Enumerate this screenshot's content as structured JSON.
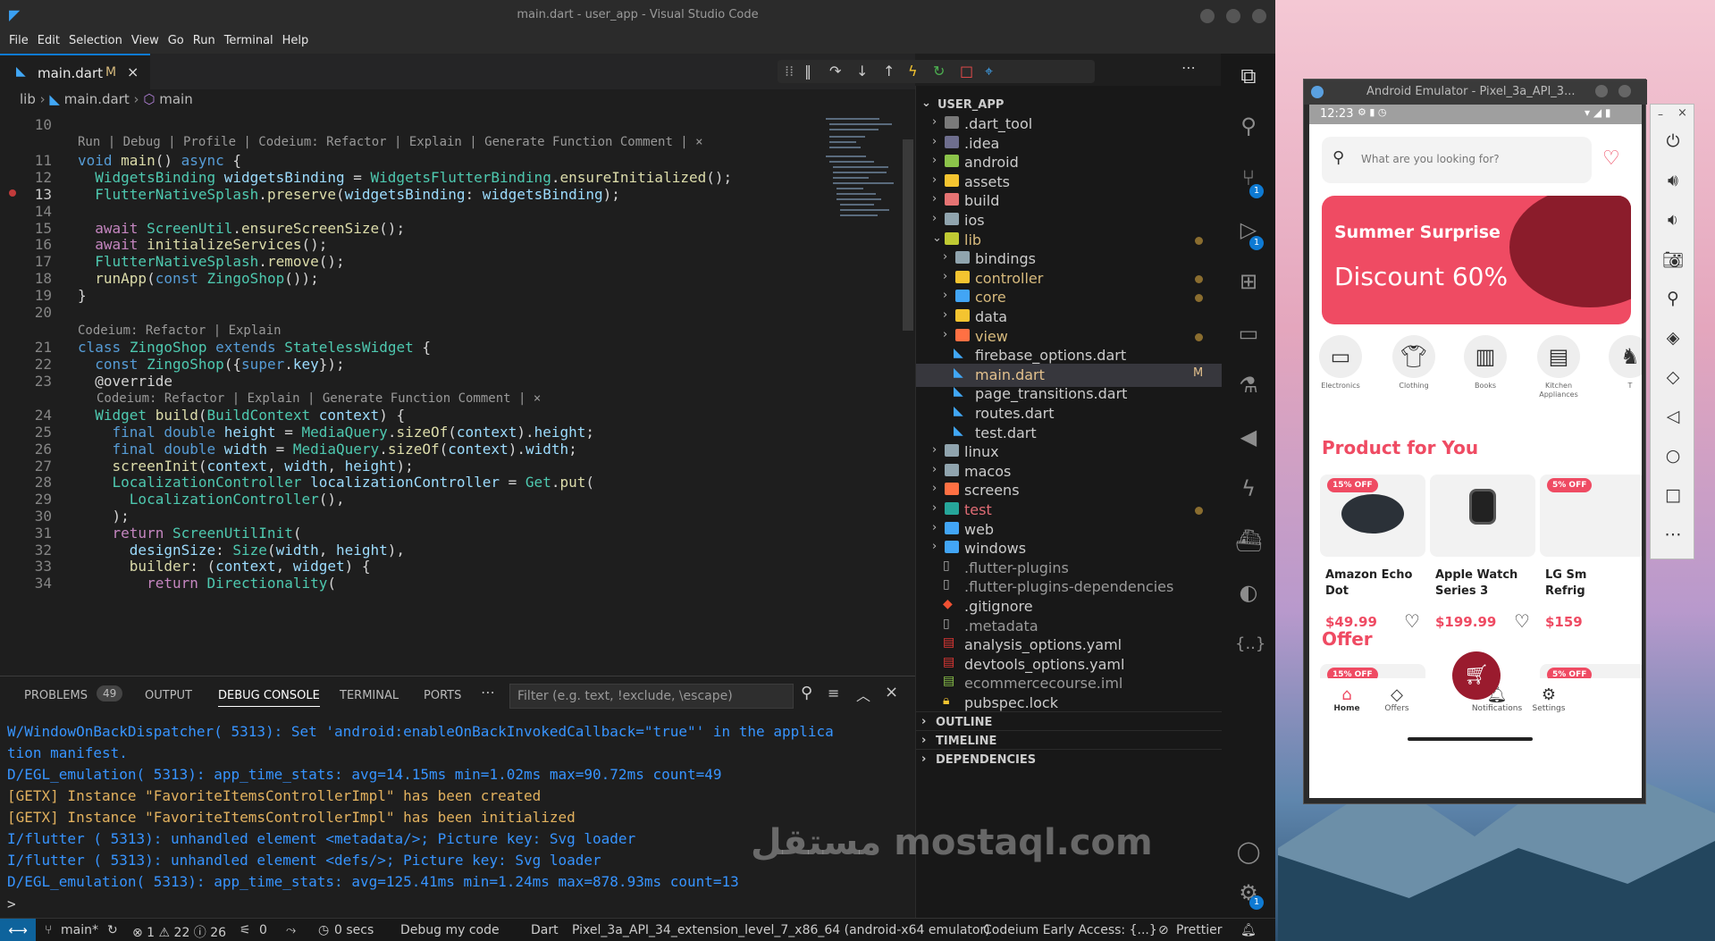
{
  "window": {
    "title": "main.dart - user_app - Visual Studio Code"
  },
  "menu": [
    "File",
    "Edit",
    "Selection",
    "View",
    "Go",
    "Run",
    "Terminal",
    "Help"
  ],
  "editor": {
    "tab": {
      "name": "main.dart",
      "status": "M",
      "close": "×"
    },
    "breadcrumb": {
      "folder": "lib",
      "file": "main.dart",
      "symbol": "main"
    },
    "lens_top": "Run | Debug | Profile | Codeium: Refactor | Explain | Generate Function Comment | ×",
    "lens_class": "Codeium: Refactor | Explain",
    "lens_build": "Codeium: Refactor | Explain | Generate Function Comment | ×",
    "line_numbers": [
      "10",
      "11",
      "12",
      "13",
      "14",
      "15",
      "16",
      "17",
      "18",
      "19",
      "20",
      "21",
      "22",
      "23",
      "24",
      "25",
      "26",
      "27",
      "28",
      "29",
      "30",
      "31",
      "32",
      "33",
      "34"
    ],
    "lines": {
      "l11": "void main() async {",
      "l12": "  WidgetsBinding widgetsBinding = WidgetsFlutterBinding.ensureInitialized();",
      "l13": "  FlutterNativeSplash.preserve(widgetsBinding: widgetsBinding);",
      "l15": "  await ScreenUtil.ensureScreenSize();",
      "l16": "  await initializeServices();",
      "l17": "  FlutterNativeSplash.remove();",
      "l18": "  runApp(const ZingoShop());",
      "l19": "}",
      "l21": "class ZingoShop extends StatelessWidget {",
      "l22": "  const ZingoShop({super.key});",
      "l23": "  @override",
      "l24": "  Widget build(BuildContext context) {",
      "l25": "    final double height = MediaQuery.sizeOf(context).height;",
      "l26": "    final double width = MediaQuery.sizeOf(context).width;",
      "l27": "    screenInit(context, width, height);",
      "l28": "    LocalizationController localizationController = Get.put(",
      "l29": "      LocalizationController(),",
      "l30": "    );",
      "l31": "    return ScreenUtilInit(",
      "l32": "      designSize: Size(width, height),",
      "l33": "      builder: (context, widget) {",
      "l34": "        return Directionality("
    }
  },
  "panel": {
    "tabs": [
      "PROBLEMS",
      "OUTPUT",
      "DEBUG CONSOLE",
      "TERMINAL",
      "PORTS"
    ],
    "problems_count": "49",
    "filter_placeholder": "Filter (e.g. text, !exclude, \\escape)",
    "console": [
      "W/WindowOnBackDispatcher( 5313): Set 'android:enableOnBackInvokedCallback=\"true\"' in the applica",
      "tion manifest.",
      "D/EGL_emulation( 5313): app_time_stats: avg=14.15ms min=1.02ms max=90.72ms count=49",
      "[GETX] Instance \"FavoriteItemsControllerImpl\" has been created",
      "[GETX] Instance \"FavoriteItemsControllerImpl\" has been initialized",
      "I/flutter ( 5313): unhandled element <metadata/>; Picture key: Svg loader",
      "I/flutter ( 5313): unhandled element <defs/>; Picture key: Svg loader",
      "D/EGL_emulation( 5313): app_time_stats: avg=125.41ms min=1.24ms max=878.93ms count=13"
    ],
    "prompt": ">"
  },
  "explorer": {
    "root": "USER_APP",
    "items": [
      {
        "label": ".dart_tool",
        "type": "folder",
        "color": "#7a7a7a"
      },
      {
        "label": ".idea",
        "type": "folder",
        "color": "#6e6e8e"
      },
      {
        "label": "android",
        "type": "folder",
        "color": "#8bc34a"
      },
      {
        "label": "assets",
        "type": "folder",
        "color": "#f4c430"
      },
      {
        "label": "build",
        "type": "folder",
        "color": "#e57373"
      },
      {
        "label": "ios",
        "type": "folder",
        "color": "#90a4ae"
      },
      {
        "label": "lib",
        "type": "folder-open",
        "color": "#c0ca33",
        "modified": true
      },
      {
        "label": "bindings",
        "type": "folder",
        "color": "#90a4ae"
      },
      {
        "label": "controller",
        "type": "folder",
        "color": "#f4c430",
        "modified": true
      },
      {
        "label": "core",
        "type": "folder",
        "color": "#42a5f5",
        "modified": true
      },
      {
        "label": "data",
        "type": "folder",
        "color": "#f4c430"
      },
      {
        "label": "view",
        "type": "folder",
        "color": "#ff7043",
        "modified": true
      },
      {
        "label": "firebase_options.dart",
        "type": "dart"
      },
      {
        "label": "main.dart",
        "type": "dart",
        "badge": "M"
      },
      {
        "label": "page_transitions.dart",
        "type": "dart"
      },
      {
        "label": "routes.dart",
        "type": "dart"
      },
      {
        "label": "test.dart",
        "type": "dart"
      },
      {
        "label": "linux",
        "type": "folder",
        "color": "#90a4ae"
      },
      {
        "label": "macos",
        "type": "folder",
        "color": "#90a4ae"
      },
      {
        "label": "screens",
        "type": "folder",
        "color": "#ff7043"
      },
      {
        "label": "test",
        "type": "folder",
        "color": "#26a69a",
        "modified": true
      },
      {
        "label": "web",
        "type": "folder",
        "color": "#42a5f5"
      },
      {
        "label": "windows",
        "type": "folder",
        "color": "#42a5f5"
      },
      {
        "label": ".flutter-plugins",
        "type": "file"
      },
      {
        "label": ".flutter-plugins-dependencies",
        "type": "file"
      },
      {
        "label": ".gitignore",
        "type": "git"
      },
      {
        "label": ".metadata",
        "type": "file"
      },
      {
        "label": "analysis_options.yaml",
        "type": "yaml"
      },
      {
        "label": "devtools_options.yaml",
        "type": "yaml"
      },
      {
        "label": "ecommercecourse.iml",
        "type": "iml"
      },
      {
        "label": "pubspec.lock",
        "type": "lock"
      }
    ],
    "sections": [
      "OUTLINE",
      "TIMELINE",
      "DEPENDENCIES"
    ]
  },
  "activity_badges": {
    "source_control": "1",
    "run_debug": "1",
    "settings": "1"
  },
  "status": {
    "branch": "main*",
    "problems": "⊗ 1 ⚠ 22 ⓘ 26",
    "ports": "0",
    "timer": "0 secs",
    "debug": "Debug my code",
    "language": "Dart",
    "device": "Pixel_3a_API_34_extension_level_7_x86_64 (android-x64 emulator)",
    "codeium": "Codeium Early Access: {...}",
    "prettier": "Prettier"
  },
  "emulator": {
    "title": "Android Emulator - Pixel_3a_API_3...",
    "time": "12:23",
    "search_placeholder": "What are you looking for?",
    "banner_title": "Summer Surprise",
    "banner_sub": "Discount 60%",
    "categories": [
      "Electronics",
      "Clothing",
      "Books",
      "Kitchen Appliances",
      "T"
    ],
    "section_products": "Product for You",
    "section_offer": "Offer",
    "products": [
      {
        "off": "15% OFF",
        "name": "Amazon Echo Dot",
        "price": "$49.99"
      },
      {
        "off": "",
        "name": "Apple Watch Series 3",
        "price": "$199.99"
      },
      {
        "off": "5% OFF",
        "name": "LG Sm Refrig",
        "price": "$159"
      }
    ],
    "offers": [
      "15% OFF",
      "5% OFF"
    ],
    "nav": [
      "Home",
      "Offers",
      "Notifications",
      "Settings"
    ]
  },
  "watermark": "مستقل mostaql.com"
}
